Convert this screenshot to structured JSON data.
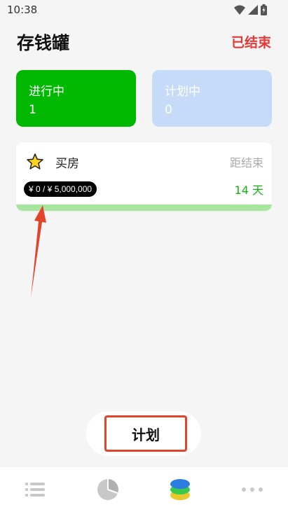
{
  "status_bar": {
    "time": "10:38"
  },
  "header": {
    "title": "存钱罐",
    "status": "已结束"
  },
  "tabs": [
    {
      "label": "进行中",
      "count": "1",
      "selected": true,
      "color": "#00b800"
    },
    {
      "label": "计划中",
      "count": "0",
      "selected": false,
      "color": "#c5dbf7"
    }
  ],
  "goal": {
    "name": "买房",
    "remaining_label": "距结束",
    "amount": "¥ 0 / ¥ 5,000,000",
    "days_left": "14 天",
    "progress": 0,
    "icon": "star-icon"
  },
  "plan_button": {
    "label": "计划"
  },
  "bottom_nav": [
    {
      "icon": "list-icon",
      "active": false
    },
    {
      "icon": "pie-chart-icon",
      "active": false
    },
    {
      "icon": "coin-stack-icon",
      "active": true
    },
    {
      "icon": "more-icon",
      "active": false
    }
  ],
  "colors": {
    "accent": "#00b800",
    "danger": "#e53935",
    "annotation": "#e0442a"
  }
}
